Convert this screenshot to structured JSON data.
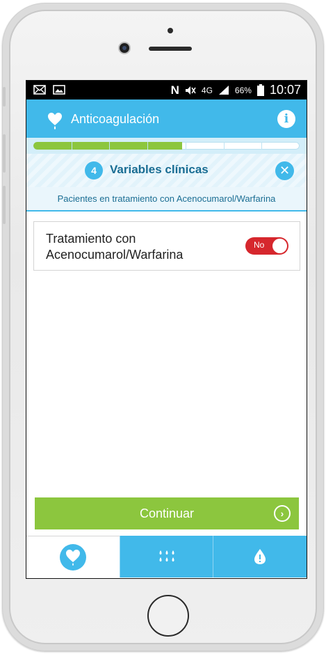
{
  "status_bar": {
    "battery": "66%",
    "time": "10:07",
    "network": "4G",
    "icons": [
      "mail-icon",
      "image-icon",
      "nfc-icon",
      "mute-icon",
      "signal-icon",
      "battery-icon"
    ]
  },
  "app_bar": {
    "title": "Anticoagulación",
    "left_icon": "heart-drop-icon",
    "right_icon": "info-icon",
    "info_glyph": "i"
  },
  "progress": {
    "fraction": 0.56,
    "segments": 7
  },
  "step": {
    "number": "4",
    "title": "Variables clínicas",
    "close_glyph": "✕"
  },
  "subtitle": "Pacientes en tratamiento con Acenocumarol/Warfarina",
  "question": {
    "label": "Tratamiento con Acenocumarol/Warfarina",
    "toggle_value": "No",
    "toggle_state": "off"
  },
  "actions": {
    "continue_label": "Continuar",
    "continue_icon": "chevron-right-circle-icon"
  },
  "bottom_nav": {
    "items": [
      {
        "icon": "heart-drop-icon",
        "active": true
      },
      {
        "icon": "drops-grid-icon",
        "active": false
      },
      {
        "icon": "drop-alert-icon",
        "active": false
      }
    ]
  },
  "colors": {
    "primary": "#41b9ea",
    "accent_green": "#8cc63e",
    "toggle_off_red": "#d6272d",
    "title_dark_blue": "#1a6d93"
  }
}
